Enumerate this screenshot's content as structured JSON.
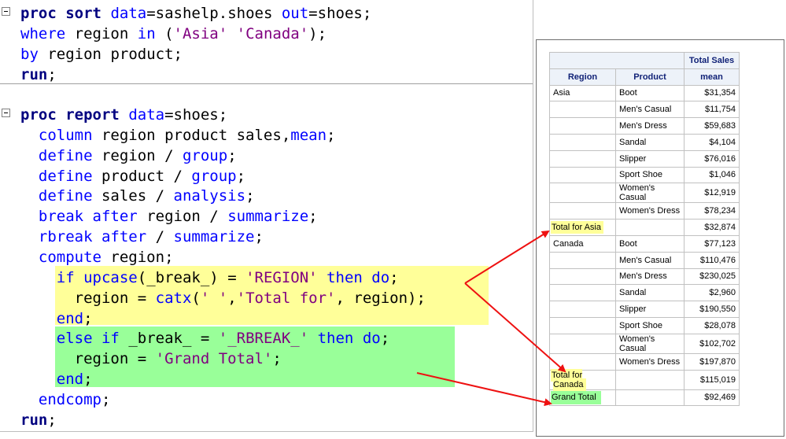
{
  "code": {
    "lines": [
      [
        "proc sort data=sashelp.shoes out=shoes;"
      ],
      [
        "where region in ('Asia' 'Canada');"
      ],
      [
        "by region product;"
      ],
      [
        "run;"
      ],
      [
        "proc report data=shoes;"
      ],
      [
        "  column region product sales,mean;"
      ],
      [
        "  define region / group;"
      ],
      [
        "  define product / group;"
      ],
      [
        "  define sales / analysis;"
      ],
      [
        "  break after region / summarize;"
      ],
      [
        "  rbreak after / summarize;"
      ],
      [
        "  compute region;"
      ],
      [
        "    if upcase(_break_) = 'REGION' then do;"
      ],
      [
        "      region = catx(' ','Total for', region);"
      ],
      [
        "    end;"
      ],
      [
        "    else if _break_ = '_RBREAK_' then do;"
      ],
      [
        "      region = 'Grand Total';"
      ],
      [
        "    end;"
      ],
      [
        "  endcomp;"
      ],
      [
        "run;"
      ]
    ]
  },
  "report": {
    "header_group": "Total Sales",
    "columns": [
      "Region",
      "Product",
      "mean"
    ],
    "rows": [
      {
        "region": "Asia",
        "product": "Boot",
        "mean": "$31,354",
        "style": ""
      },
      {
        "region": "",
        "product": "Men's Casual",
        "mean": "$11,754",
        "style": ""
      },
      {
        "region": "",
        "product": "Men's Dress",
        "mean": "$59,683",
        "style": ""
      },
      {
        "region": "",
        "product": "Sandal",
        "mean": "$4,104",
        "style": ""
      },
      {
        "region": "",
        "product": "Slipper",
        "mean": "$76,016",
        "style": ""
      },
      {
        "region": "",
        "product": "Sport Shoe",
        "mean": "$1,046",
        "style": ""
      },
      {
        "region": "",
        "product": "Women's Casual",
        "mean": "$12,919",
        "style": ""
      },
      {
        "region": "",
        "product": "Women's Dress",
        "mean": "$78,234",
        "style": ""
      },
      {
        "region": "Total for Asia",
        "product": "",
        "mean": "$32,874",
        "style": "total"
      },
      {
        "region": "Canada",
        "product": "Boot",
        "mean": "$77,123",
        "style": ""
      },
      {
        "region": "",
        "product": "Men's Casual",
        "mean": "$110,476",
        "style": ""
      },
      {
        "region": "",
        "product": "Men's Dress",
        "mean": "$230,025",
        "style": ""
      },
      {
        "region": "",
        "product": "Sandal",
        "mean": "$2,960",
        "style": ""
      },
      {
        "region": "",
        "product": "Slipper",
        "mean": "$190,550",
        "style": ""
      },
      {
        "region": "",
        "product": "Sport Shoe",
        "mean": "$28,078",
        "style": ""
      },
      {
        "region": "",
        "product": "Women's Casual",
        "mean": "$102,702",
        "style": ""
      },
      {
        "region": "",
        "product": "Women's Dress",
        "mean": "$197,870",
        "style": ""
      },
      {
        "region": "Total for Canada",
        "product": "",
        "mean": "$115,019",
        "style": "total"
      },
      {
        "region": "Grand Total",
        "product": "",
        "mean": "$92,469",
        "style": "grand"
      }
    ]
  },
  "colors": {
    "highlight_yellow": "#ffff99",
    "highlight_green": "#99ff99",
    "arrow": "#ee1111",
    "keyword": "#000080",
    "blue_keyword": "#0000ff",
    "string": "#800080",
    "header_text": "#112277"
  }
}
